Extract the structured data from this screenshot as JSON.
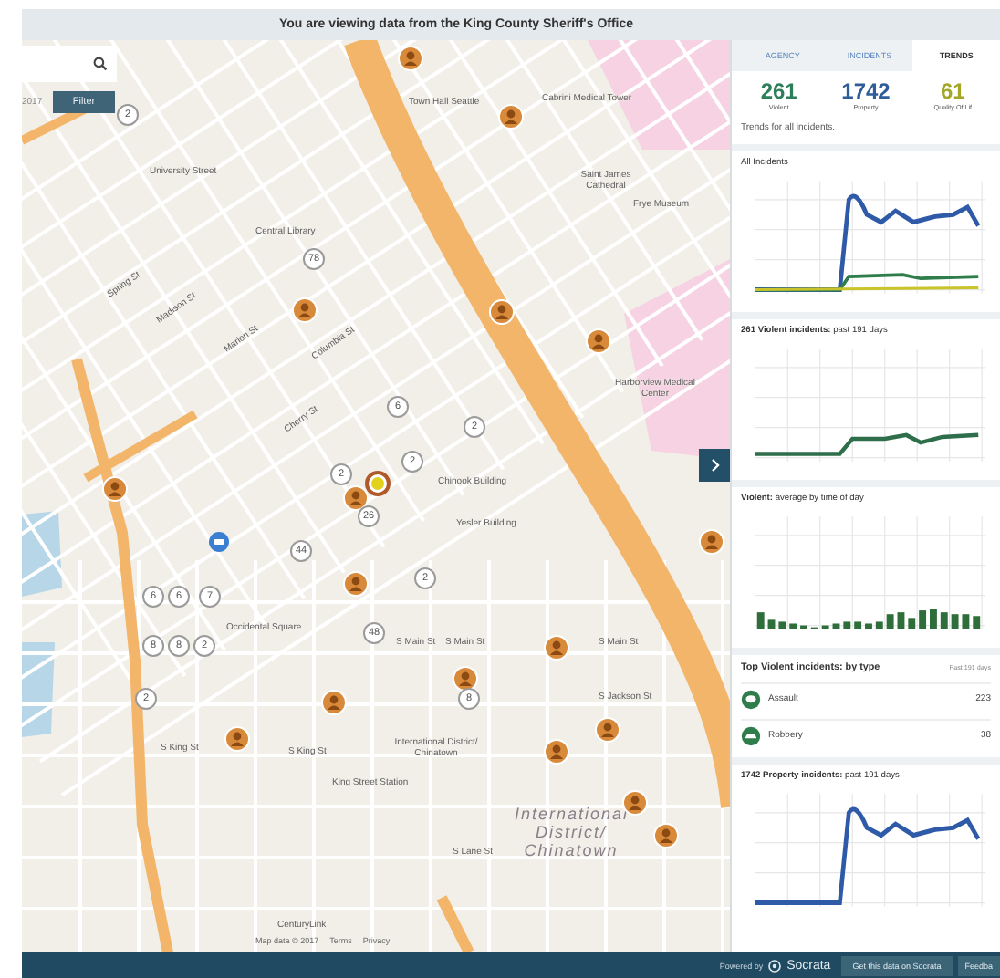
{
  "banner": "You are viewing data from the King County Sheriff's Office",
  "map": {
    "date_fragment": "2017",
    "filter_button": "Filter",
    "labels": [
      {
        "text": "Town Hall Seattle",
        "kind": "place"
      },
      {
        "text": "Cabrini Medical Tower",
        "kind": "place"
      },
      {
        "text": "University Street",
        "kind": "place"
      },
      {
        "text": "Central Library",
        "kind": "place"
      },
      {
        "text": "Saint James Cathedral",
        "kind": "place"
      },
      {
        "text": "Frye Museum",
        "kind": "place"
      },
      {
        "text": "Spring St",
        "kind": "street"
      },
      {
        "text": "Madison St",
        "kind": "street"
      },
      {
        "text": "Marion St",
        "kind": "street"
      },
      {
        "text": "Columbia St",
        "kind": "street"
      },
      {
        "text": "Cherry St",
        "kind": "street"
      },
      {
        "text": "Harborview Medical Center",
        "kind": "place"
      },
      {
        "text": "Chinook Building",
        "kind": "place"
      },
      {
        "text": "Yesler Building",
        "kind": "place"
      },
      {
        "text": "Occidental Square",
        "kind": "place"
      },
      {
        "text": "S Main St",
        "kind": "street"
      },
      {
        "text": "S Main St",
        "kind": "street"
      },
      {
        "text": "S Main St",
        "kind": "street"
      },
      {
        "text": "S Jackson St",
        "kind": "street"
      },
      {
        "text": "S King St",
        "kind": "street"
      },
      {
        "text": "S King St",
        "kind": "street"
      },
      {
        "text": "International District/ Chinatown",
        "kind": "place"
      },
      {
        "text": "King Street Station",
        "kind": "place"
      },
      {
        "text": "S Lane St",
        "kind": "street"
      },
      {
        "text": "International District/ Chinatown",
        "kind": "district"
      },
      {
        "text": "CenturyLink",
        "kind": "place"
      }
    ],
    "clusters": [
      "2",
      "78",
      "6",
      "2",
      "2",
      "2",
      "26",
      "44",
      "2",
      "48",
      "6",
      "6",
      "7",
      "8",
      "8",
      "2",
      "2",
      "8"
    ],
    "attribution": [
      "Map data © 2017",
      "Terms",
      "Privacy"
    ]
  },
  "panel": {
    "tabs": [
      {
        "label": "AGENCY",
        "selected": false
      },
      {
        "label": "INCIDENTS",
        "selected": false
      },
      {
        "label": "TRENDS",
        "selected": true
      }
    ],
    "stats": [
      {
        "value": "261",
        "label": "Violent",
        "color": "#2e7d5b"
      },
      {
        "value": "1742",
        "label": "Property",
        "color": "#2f5d9a"
      },
      {
        "value": "61",
        "label": "Quality Of Lif",
        "color": "#a3a626"
      }
    ],
    "intro": "Trends for all incidents.",
    "charts": [
      {
        "title": "All Incidents",
        "kind": "multi"
      },
      {
        "title": "**261 Violent incidents:** past 191 days",
        "kind": "violent"
      },
      {
        "title": "**Violent:** average by time of day",
        "kind": "bars"
      }
    ],
    "top_types": {
      "title": "Top Violent incidents: by type",
      "period": "Past 191 days",
      "items": [
        {
          "name": "Assault",
          "count": "223",
          "kind": "bubble"
        },
        {
          "name": "Robbery",
          "count": "38",
          "kind": "car"
        }
      ]
    },
    "property_chart": {
      "title": "**1742 Property incidents:** past 191 days",
      "kind": "property"
    }
  },
  "footer": {
    "powered_by": "Powered by",
    "brand": "Socrata",
    "button": "Get this data on Socrata",
    "feedback": "Feedba"
  }
}
